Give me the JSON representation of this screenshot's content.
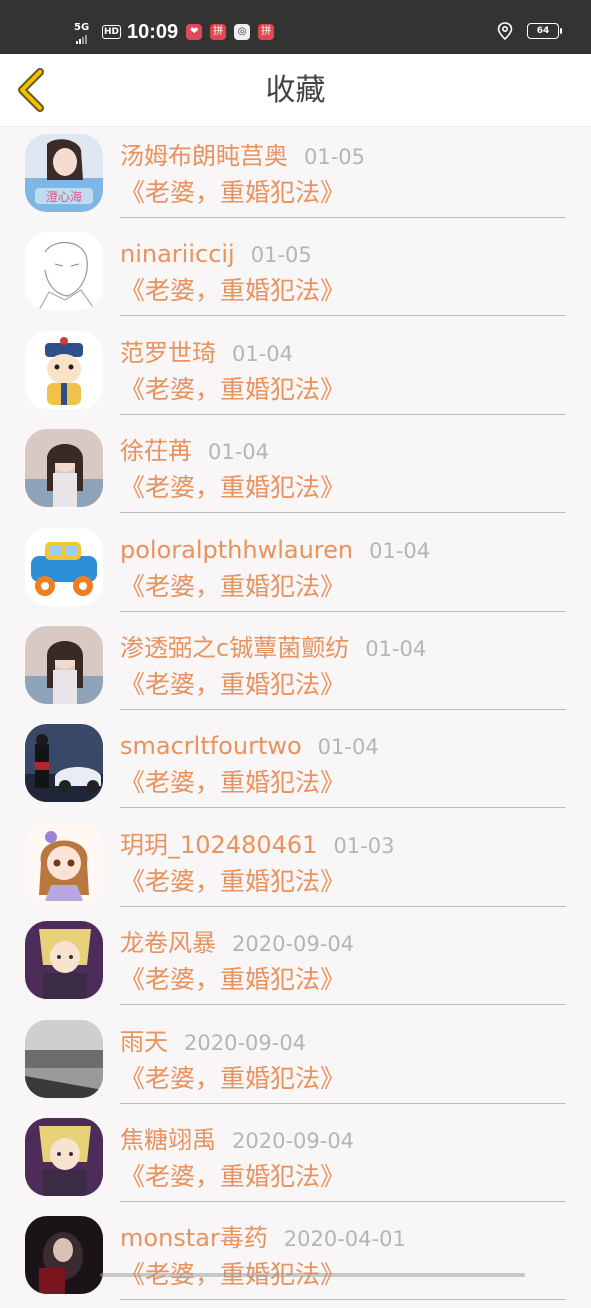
{
  "status": {
    "network": "5G",
    "hd": "HD",
    "time": "10:09",
    "battery": "64",
    "apps": [
      {
        "icon": "heart-app-icon",
        "color": "#e2485a"
      },
      {
        "icon": "pinduoduo-app-icon",
        "color": "#e0484f"
      },
      {
        "icon": "browser-app-icon",
        "color": "#eeeeee"
      },
      {
        "icon": "pinduoduo-app-icon",
        "color": "#e0484f"
      }
    ]
  },
  "header": {
    "title": "收藏",
    "back_icon": "chevron-left-icon",
    "accent": "#e6b800"
  },
  "colors": {
    "username": "#e8925e",
    "date": "#b5b5b5",
    "title": "#e8925e"
  },
  "favorites": [
    {
      "user": "汤姆布朗盹莒奥",
      "date": "01-05",
      "title": "《老婆，重婚犯法》",
      "avatar": "girl-photo"
    },
    {
      "user": "ninariiccij",
      "date": "01-05",
      "title": "《老婆，重婚犯法》",
      "avatar": "sketch"
    },
    {
      "user": "范罗世琦",
      "date": "01-04",
      "title": "《老婆，重婚犯法》",
      "avatar": "cartoon-emperor"
    },
    {
      "user": "徐茌苒",
      "date": "01-04",
      "title": "《老婆，重婚犯法》",
      "avatar": "girl-photo"
    },
    {
      "user": "poloralpthhwlauren",
      "date": "01-04",
      "title": "《老婆，重婚犯法》",
      "avatar": "toy-car"
    },
    {
      "user": "渗透弼之c铖蕈菌颤纺",
      "date": "01-04",
      "title": "《老婆，重婚犯法》",
      "avatar": "girl-photo"
    },
    {
      "user": "smacrltfourtwo",
      "date": "01-04",
      "title": "《老婆，重婚犯法》",
      "avatar": "car-photo"
    },
    {
      "user": "玥玥_102480461",
      "date": "01-03",
      "title": "《老婆，重婚犯法》",
      "avatar": "cartoon-girl"
    },
    {
      "user": "龙卷风暴",
      "date": "2020-09-04",
      "title": "《老婆，重婚犯法》",
      "avatar": "anime"
    },
    {
      "user": "雨天",
      "date": "2020-09-04",
      "title": "《老婆，重婚犯法》",
      "avatar": "bw-photo"
    },
    {
      "user": "焦糖翊禹",
      "date": "2020-09-04",
      "title": "《老婆，重婚犯法》",
      "avatar": "anime"
    },
    {
      "user": "monstar毒药",
      "date": "2020-04-01",
      "title": "《老婆，重婚犯法》",
      "avatar": "dark-photo"
    }
  ]
}
